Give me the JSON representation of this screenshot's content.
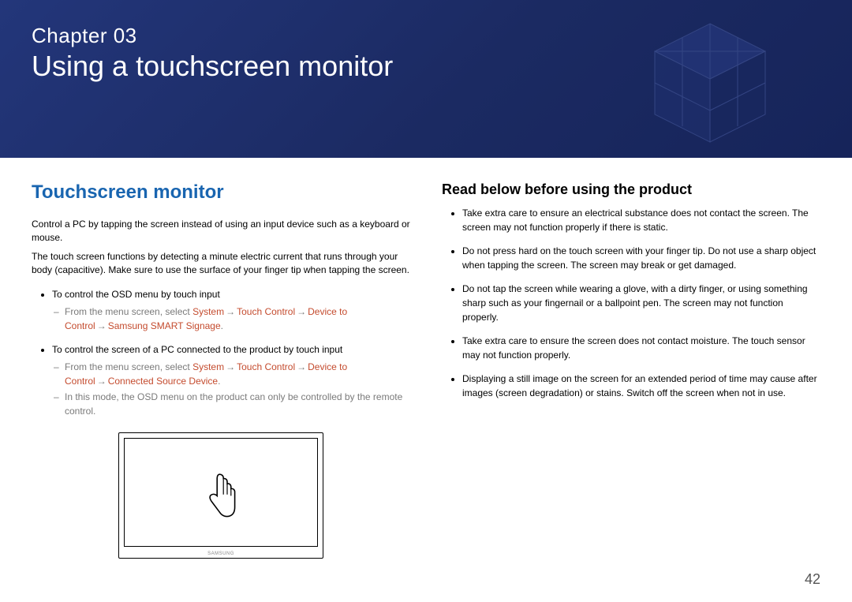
{
  "banner": {
    "chapter": "Chapter 03",
    "title": "Using a touchscreen monitor"
  },
  "left": {
    "heading": "Touchscreen monitor",
    "para1": "Control a PC by tapping the screen instead of using an input device such as a keyboard or mouse.",
    "para2": "The touch screen functions by detecting a minute electric current that runs through your body (capacitive). Make sure to use the surface of your finger tip when tapping the screen.",
    "item1": "To control the OSD menu by touch input",
    "item1_sub_prefix": "From the menu screen, select ",
    "menu": {
      "system": "System",
      "touch_control": "Touch Control",
      "device_to_control": "Device to Control",
      "samsung_smart_signage": "Samsung SMART Signage",
      "connected_source_device": "Connected Source Device"
    },
    "arrow": "→",
    "period": ".",
    "item2": "To control the screen of a PC connected to the product by touch input",
    "item2_sub_prefix": "From the menu screen, select ",
    "item2_note": "In this mode, the OSD menu on the product can only be controlled by the remote control.",
    "monitor_brand": "SAMSUNG"
  },
  "right": {
    "heading": "Read below before using the product",
    "b1": "Take extra care to ensure an electrical substance does not contact the screen. The screen may not function properly if there is static.",
    "b2": "Do not press hard on the touch screen with your finger tip. Do not use a sharp object when tapping the screen. The screen may break or get damaged.",
    "b3": "Do not tap the screen while wearing a glove, with a dirty finger, or using something sharp such as your fingernail or a ballpoint pen. The screen may not function properly.",
    "b4": "Take extra care to ensure the screen does not contact moisture. The touch sensor may not function properly.",
    "b5": "Displaying a still image on the screen for an extended period of time may cause after images (screen degradation) or stains. Switch off the screen when not in use."
  },
  "page_number": "42"
}
